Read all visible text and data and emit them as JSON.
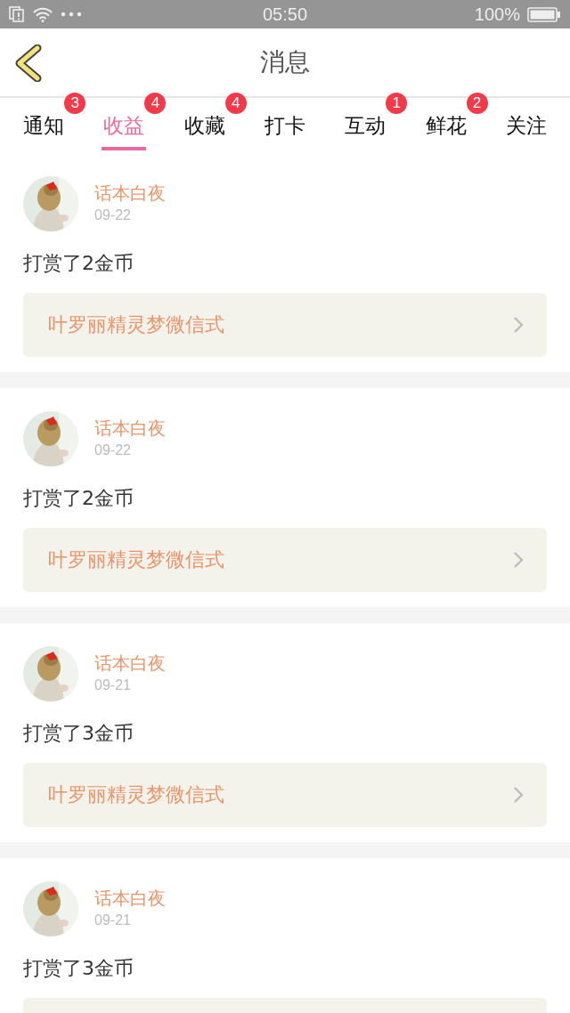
{
  "status_bar": {
    "time": "05:50",
    "battery": "100%"
  },
  "header": {
    "title": "消息"
  },
  "tabs": [
    {
      "label": "通知",
      "badge": "3",
      "selected": false
    },
    {
      "label": "收益",
      "badge": "4",
      "selected": true
    },
    {
      "label": "收藏",
      "badge": "4",
      "selected": false
    },
    {
      "label": "打卡",
      "selected": false
    },
    {
      "label": "互动",
      "badge": "1",
      "selected": false
    },
    {
      "label": "鲜花",
      "badge": "2",
      "selected": false
    },
    {
      "label": "关注",
      "selected": false
    }
  ],
  "messages": [
    {
      "user": "话本白夜",
      "date": "09-22",
      "text": "打赏了2金币",
      "link": "叶罗丽精灵梦微信式"
    },
    {
      "user": "话本白夜",
      "date": "09-22",
      "text": "打赏了2金币",
      "link": "叶罗丽精灵梦微信式"
    },
    {
      "user": "话本白夜",
      "date": "09-21",
      "text": "打赏了3金币",
      "link": "叶罗丽精灵梦微信式"
    },
    {
      "user": "话本白夜",
      "date": "09-21",
      "text": "打赏了3金币"
    }
  ]
}
